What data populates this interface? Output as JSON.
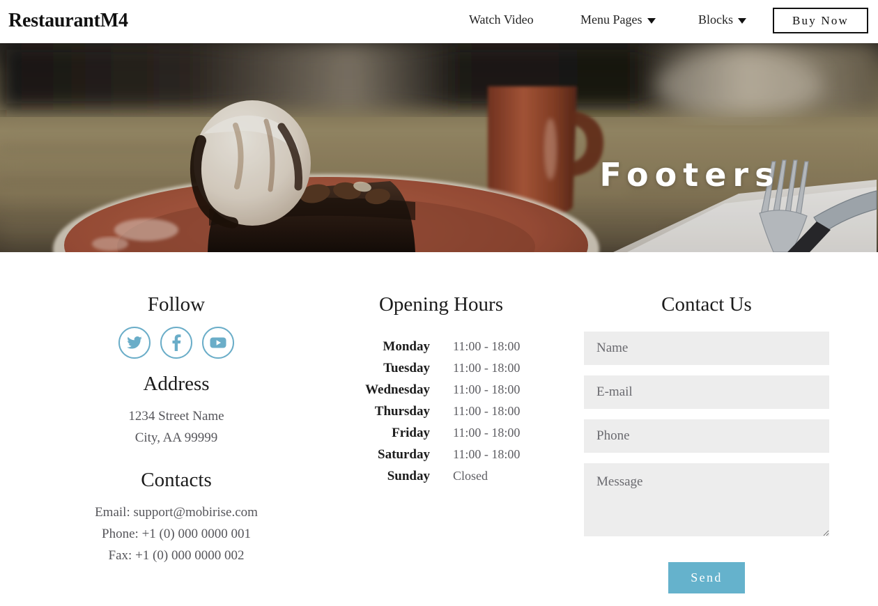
{
  "navbar": {
    "brand": "RestaurantM4",
    "links": [
      {
        "label": "Watch Video",
        "icon": "",
        "has_caret": false
      },
      {
        "label": "Menu Pages",
        "icon": "chevron-down-icon",
        "has_caret": true
      },
      {
        "label": "Blocks",
        "icon": "chevron-down-icon",
        "has_caret": true
      }
    ],
    "cta": "Buy Now"
  },
  "hero": {
    "title": "Footers",
    "image_description": "chocolate brownie dessert with vanilla ice cream on terracotta plate, mug and cutlery on wooden table"
  },
  "follow": {
    "title": "Follow",
    "socials": [
      {
        "name": "twitter-icon",
        "label": "Twitter"
      },
      {
        "name": "facebook-icon",
        "label": "Facebook"
      },
      {
        "name": "youtube-icon",
        "label": "YouTube"
      }
    ]
  },
  "address": {
    "title": "Address",
    "line1": "1234 Street Name",
    "line2": "City, AA 99999"
  },
  "contacts": {
    "title": "Contacts",
    "email": "Email: support@mobirise.com",
    "phone": "Phone: +1 (0) 000 0000 001",
    "fax": "Fax: +1 (0) 000 0000 002"
  },
  "opening_hours": {
    "title": "Opening Hours",
    "rows": [
      {
        "day": "Monday",
        "time": "11:00 - 18:00"
      },
      {
        "day": "Tuesday",
        "time": "11:00 - 18:00"
      },
      {
        "day": "Wednesday",
        "time": "11:00 - 18:00"
      },
      {
        "day": "Thursday",
        "time": "11:00 - 18:00"
      },
      {
        "day": "Friday",
        "time": "11:00 - 18:00"
      },
      {
        "day": "Saturday",
        "time": "11:00 - 18:00"
      },
      {
        "day": "Sunday",
        "time": "Closed"
      }
    ]
  },
  "contact_form": {
    "title": "Contact Us",
    "fields": [
      {
        "name": "name",
        "placeholder": "Name",
        "value": ""
      },
      {
        "name": "email",
        "placeholder": "E-mail",
        "value": ""
      },
      {
        "name": "phone",
        "placeholder": "Phone",
        "value": ""
      },
      {
        "name": "message",
        "placeholder": "Message",
        "value": ""
      }
    ],
    "submit_label": "Send"
  },
  "colors": {
    "accent": "#65b2cc",
    "social_outline": "#6aadc8",
    "field_bg": "#ededed",
    "text_dark": "#1b1b1b",
    "text_muted": "#55555a"
  }
}
